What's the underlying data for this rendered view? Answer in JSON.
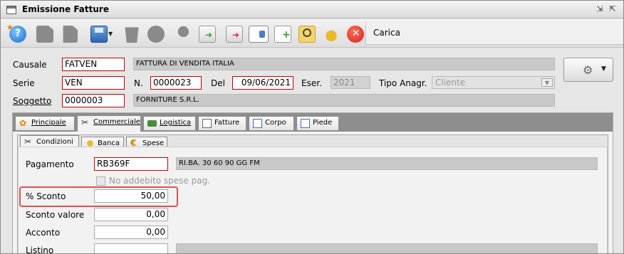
{
  "window": {
    "title": "Emissione Fatture"
  },
  "toolbar": {
    "status_text": "Carica",
    "icons": [
      "help-icon",
      "new-doc-icon",
      "copy-doc-icon",
      "save-icon",
      "delete-icon",
      "search-icon",
      "pin-icon",
      "export-icon",
      "import-icon",
      "card-icon",
      "add-doc-icon",
      "find-doc-icon",
      "coins-icon",
      "close-icon"
    ]
  },
  "header": {
    "causale_label": "Causale",
    "causale_code": "FATVEN",
    "causale_desc": "FATTURA DI VENDITA ITALIA",
    "serie_label": "Serie",
    "serie_code": "VEN",
    "numero_label": "N.",
    "numero_value": "0000023",
    "del_label": "Del",
    "del_value": "09/06/2021",
    "eser_label": "Eser.",
    "eser_value": "2021",
    "tipo_label": "Tipo Anagr.",
    "tipo_value": "Cliente",
    "soggetto_label": "Soggetto",
    "soggetto_code": "0000003",
    "soggetto_desc": "FORNITURE S.R.L."
  },
  "tabs": {
    "main": [
      "Principale",
      "Commerciale",
      "Logistica",
      "Fatture",
      "Corpo",
      "Piede"
    ],
    "active_main": "Commerciale",
    "sub": [
      "Condizioni",
      "Banca",
      "Spese"
    ],
    "active_sub": "Condizioni"
  },
  "condizioni": {
    "pagamento_label": "Pagamento",
    "pagamento_code": "RB369F",
    "pagamento_desc": "RI.BA. 30 60 90 GG FM",
    "no_addebito_label": "No addebito spese pag.",
    "sconto_label": "% Sconto",
    "sconto_value": "50,00",
    "sconto_valore_label": "Sconto valore",
    "sconto_valore_value": "0,00",
    "acconto_label": "Acconto",
    "acconto_value": "0,00",
    "listino_label": "Listino",
    "listino_value": ""
  },
  "colors": {
    "required_border": "#c00000",
    "highlight": "#d9534f"
  }
}
